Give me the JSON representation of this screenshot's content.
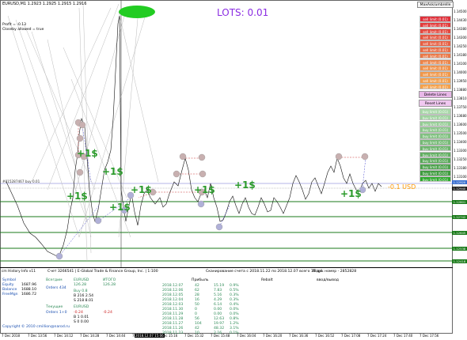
{
  "header": {
    "title": "EURUSD,M1  1.2923 1.2925 1.2915 1.2916",
    "profit_line": "Profit = -0.13",
    "closeby_line": "Closeby allowed = true"
  },
  "lots_label": "LOTS: 0.01",
  "max_button": "MaxAsk/umbrelle",
  "sell_buttons": [
    "sell limit (0.01)",
    "sell limit (0.01)",
    "sell limit (0.01)",
    "sell limit (0.01)",
    "sell limit (0.01)",
    "sell limit (0.01)",
    "sell limit (0.01)",
    "sell limit (0.01)",
    "sell limit (0.01)",
    "sell limit (0.01)",
    "sell limit (0.01)",
    "sell limit (0.01)"
  ],
  "delete_button": "Delete Lines",
  "reset_button": "Reset Lines",
  "buy_buttons": [
    "buy limit (0.01)",
    "buy limit (0.01)",
    "buy limit (0.01)",
    "buy limit (0.01)",
    "buy limit (0.01)",
    "buy limit (0.01)",
    "buy limit (0.01)",
    "buy limit (0.01)",
    "buy limit (0.01)",
    "buy limit (0.01)",
    "buy limit (0.01)",
    "buy limit (0.01)"
  ],
  "colors": {
    "sell_top": "#e0303a",
    "sell_mid": "#e96a45",
    "sell_bottom": "#f5a14a",
    "buy_top": "#8cc48c",
    "buy_mid": "#6ab56a",
    "buy_bottom": "#2ea82e",
    "delete": "#e8b8e8",
    "reset": "#f0c8f0",
    "profit_text": "#2a9a2a",
    "usd_text": "#ff9900",
    "lots_text": "#8a2be2"
  },
  "price_labels": [
    "1.14500",
    "1.14430",
    "1.14380",
    "1.14300",
    "1.14250",
    "1.14180",
    "1.14100",
    "1.14000",
    "1.13950",
    "1.13880",
    "1.13810",
    "1.13750",
    "1.13680",
    "1.13600",
    "1.13500",
    "1.13400",
    "1.13300",
    "1.13250",
    "1.13180",
    "1.13100"
  ],
  "price_tags": [
    "1.12920",
    "1.12940",
    "1.12801",
    "1.12742",
    "1.12645",
    "1.12538",
    "1.12418"
  ],
  "order_label": "#815287467 buy 0.01",
  "profit_marks": [
    "+1$",
    "+1$",
    "+1$",
    "+1$",
    "+1$",
    "+1$",
    "+1$",
    "+1$"
  ],
  "usd_label": "-0.1 USD",
  "panel": {
    "header": "cm History Info v11",
    "account": "Счет 3266541 | E-Global Trade & Finance Group, Inc. | 1:100",
    "scan": "Сканирование счета с 2018.11.22 по 2018.12.07 всего 15 дн.",
    "magic": "Magik номер - 2852828",
    "symbol_label": "Symbol",
    "equity_label": "Equity",
    "balance_label": "Balance",
    "freemargin_label": "FreeMgn",
    "symbol_val": "",
    "equity_val": "1687.96",
    "balance_val": "1688.10",
    "freemargin_val": "1686.72",
    "col_total": "Всегдим",
    "col_pair": "EURUSD",
    "col_itogo": "ИТОГО",
    "val1": "126.28",
    "val2": "126.28",
    "orders_label": "Orders 434",
    "buy_lbl": "Buy  0.8",
    "b_line": "B 216   2.54",
    "s_line": "S 218   8.01",
    "current_lbl": "Текущие",
    "current_pair": "EURUSD",
    "orders_now": "Orders 1+0",
    "cur_val1": "-0.24",
    "cur_val2": "-0.24",
    "cur_b": "B 1   0.01",
    "cur_s": "S 0   0.00",
    "copyright": "Copyright © 2010 cmillion@narod.ru",
    "table_header_profit": "Прибыль",
    "table_header_rebate": "Rebalt",
    "table_header_io": "ввод/вывод",
    "rows": [
      [
        "2018.12.07",
        "42",
        "15.19",
        "0.9%"
      ],
      [
        "2018.12.06",
        "62",
        "7.83",
        "0.5%"
      ],
      [
        "2018.12.05",
        "28",
        "5.16",
        "0.3%"
      ],
      [
        "2018.12.04",
        "16",
        "4.29",
        "0.3%"
      ],
      [
        "2018.12.03",
        "50",
        "6.14",
        "0.4%"
      ],
      [
        "2018.11.30",
        "0",
        "0.00",
        "0.0%"
      ],
      [
        "2018.11.29",
        "0",
        "0.00",
        "0.0%"
      ],
      [
        "2018.11.28",
        "56",
        "12.63",
        "0.8%"
      ],
      [
        "2018.11.27",
        "104",
        "19.97",
        "1.2%"
      ],
      [
        "2018.11.26",
        "42",
        "48.32",
        "3.1%"
      ],
      [
        "2018.11.23",
        "10",
        "2.16",
        "0.1%"
      ]
    ]
  },
  "time_labels": [
    "7 Dec 2018",
    "7 Dec 13:56",
    "7 Dec 14:12",
    "7 Dec 14:28",
    "7 Dec 14:44",
    "7 Dec 15:00",
    "7 Dec 15:16",
    "7 Dec 15:32",
    "7 Dec 15:48",
    "7 Dec 16:04",
    "7 Dec 16:20",
    "7 Dec 16:36",
    "7 Dec 16:52",
    "7 Dec 17:08",
    "7 Dec 17:24",
    "7 Dec 17:40",
    "7 Dec 17:56"
  ],
  "time_highlight": "2018.12.07 15:06"
}
